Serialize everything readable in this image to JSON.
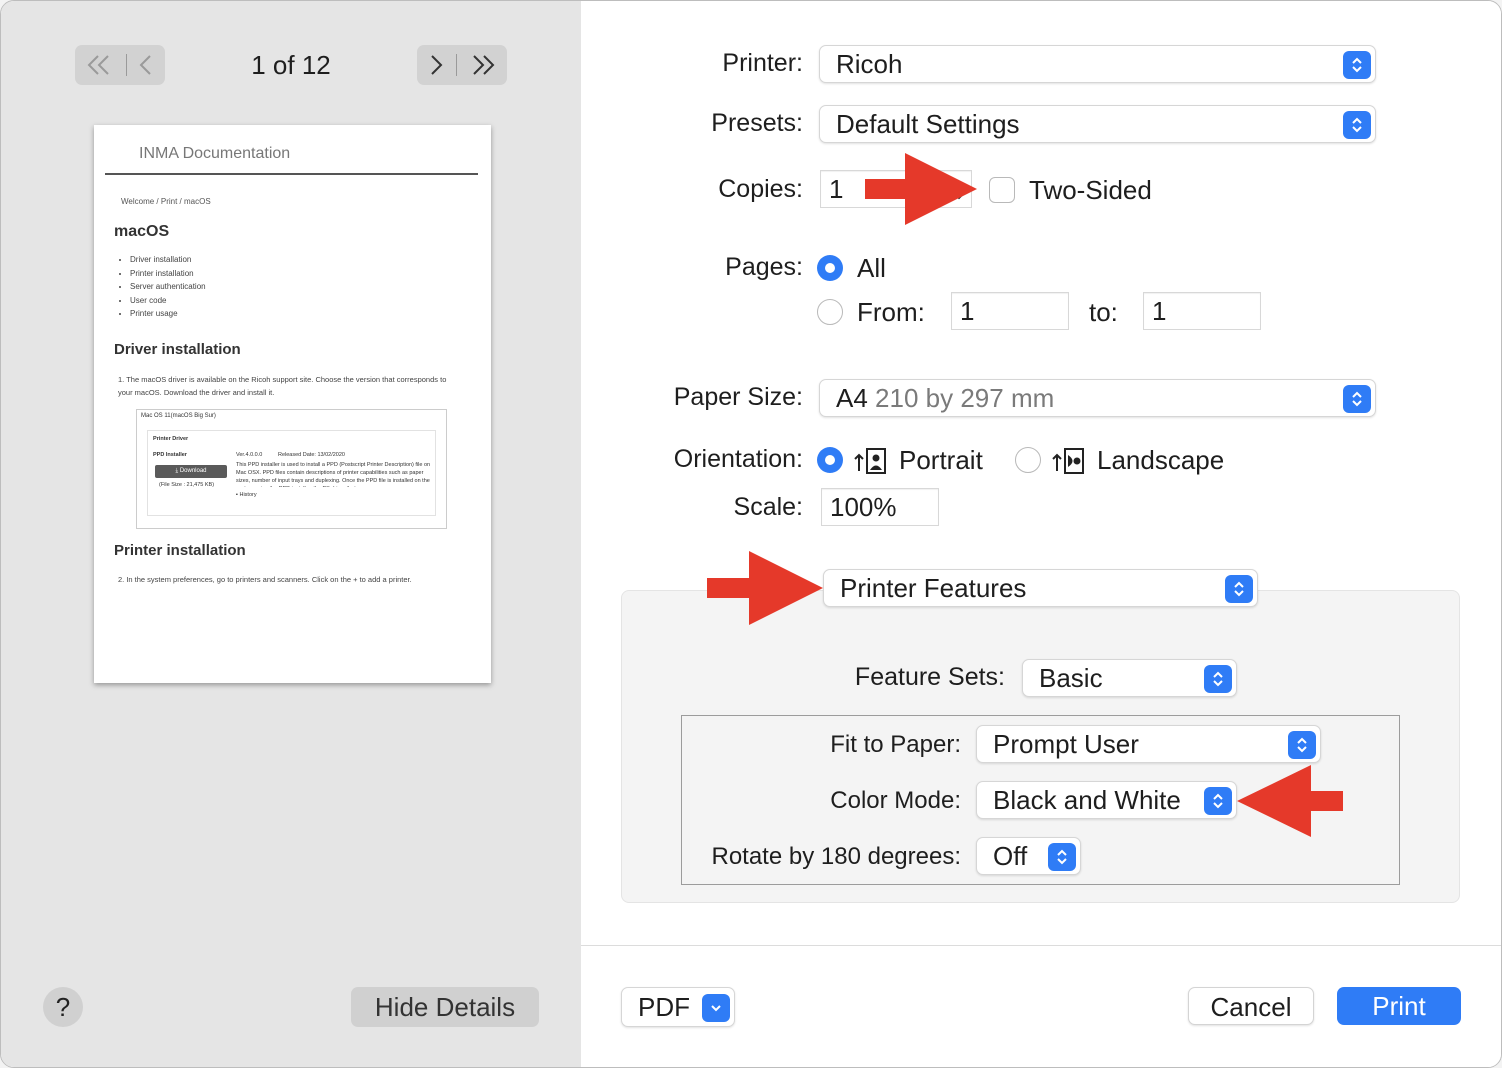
{
  "preview": {
    "page_indicator": "1 of 12",
    "document": {
      "header": "INMA Documentation",
      "breadcrumb": "Welcome / Print / macOS",
      "title": "macOS",
      "toc": [
        "Driver installation",
        "Printer installation",
        "Server authentication",
        "User code",
        "Printer usage"
      ],
      "section1_title": "Driver installation",
      "step1": "1.  The macOS driver is available on the Ricoh support site. Choose the version that corresponds to your macOS. Download the driver and install it.",
      "box_title": "Mac OS 11(macOS Big Sur)",
      "box_subtitle": "Printer Driver",
      "ppd_label": "PPD Installer",
      "version": "Ver.4.0.0.0",
      "released": "Released Date: 13/02/2020",
      "download_label": "Download",
      "file_size": "(File Size : 21,475 KB)",
      "ppd_description": "This PPD installer is used to install a PPD (Postscript Printer Description) file on Mac OSX. PPD files contain descriptions of printer capabilities such as paper sizes, number of input trays and duplexing. Once the PPD file is installed on the system using the PPD installer, the PS driver that comes",
      "history_label": "History",
      "section2_title": "Printer installation",
      "step2": "2.  In the system preferences, go to printers and scanners. Click on the + to add a printer."
    },
    "help_label": "?",
    "hide_details_label": "Hide Details"
  },
  "settings": {
    "printer_label": "Printer:",
    "printer_value": "Ricoh",
    "presets_label": "Presets:",
    "presets_value": "Default Settings",
    "copies_label": "Copies:",
    "copies_value": "1",
    "two_sided_label": "Two-Sided",
    "pages_label": "Pages:",
    "pages_all_label": "All",
    "pages_from_label": "From:",
    "pages_from_value": "1",
    "pages_to_label": "to:",
    "pages_to_value": "1",
    "paper_size_label": "Paper Size:",
    "paper_size_value": "A4",
    "paper_size_detail": "210 by 297 mm",
    "orientation_label": "Orientation:",
    "portrait_label": "Portrait",
    "landscape_label": "Landscape",
    "scale_label": "Scale:",
    "scale_value": "100%",
    "section_popup_value": "Printer Features",
    "feature_sets_label": "Feature Sets:",
    "feature_sets_value": "Basic",
    "fit_to_paper_label": "Fit to Paper:",
    "fit_to_paper_value": "Prompt User",
    "color_mode_label": "Color Mode:",
    "color_mode_value": "Black and White",
    "rotate_label": "Rotate by 180 degrees:",
    "rotate_value": "Off"
  },
  "footer": {
    "pdf_label": "PDF",
    "cancel_label": "Cancel",
    "print_label": "Print"
  },
  "colors": {
    "accent": "#2f7cf6",
    "annotation_arrow": "#e5392a"
  }
}
